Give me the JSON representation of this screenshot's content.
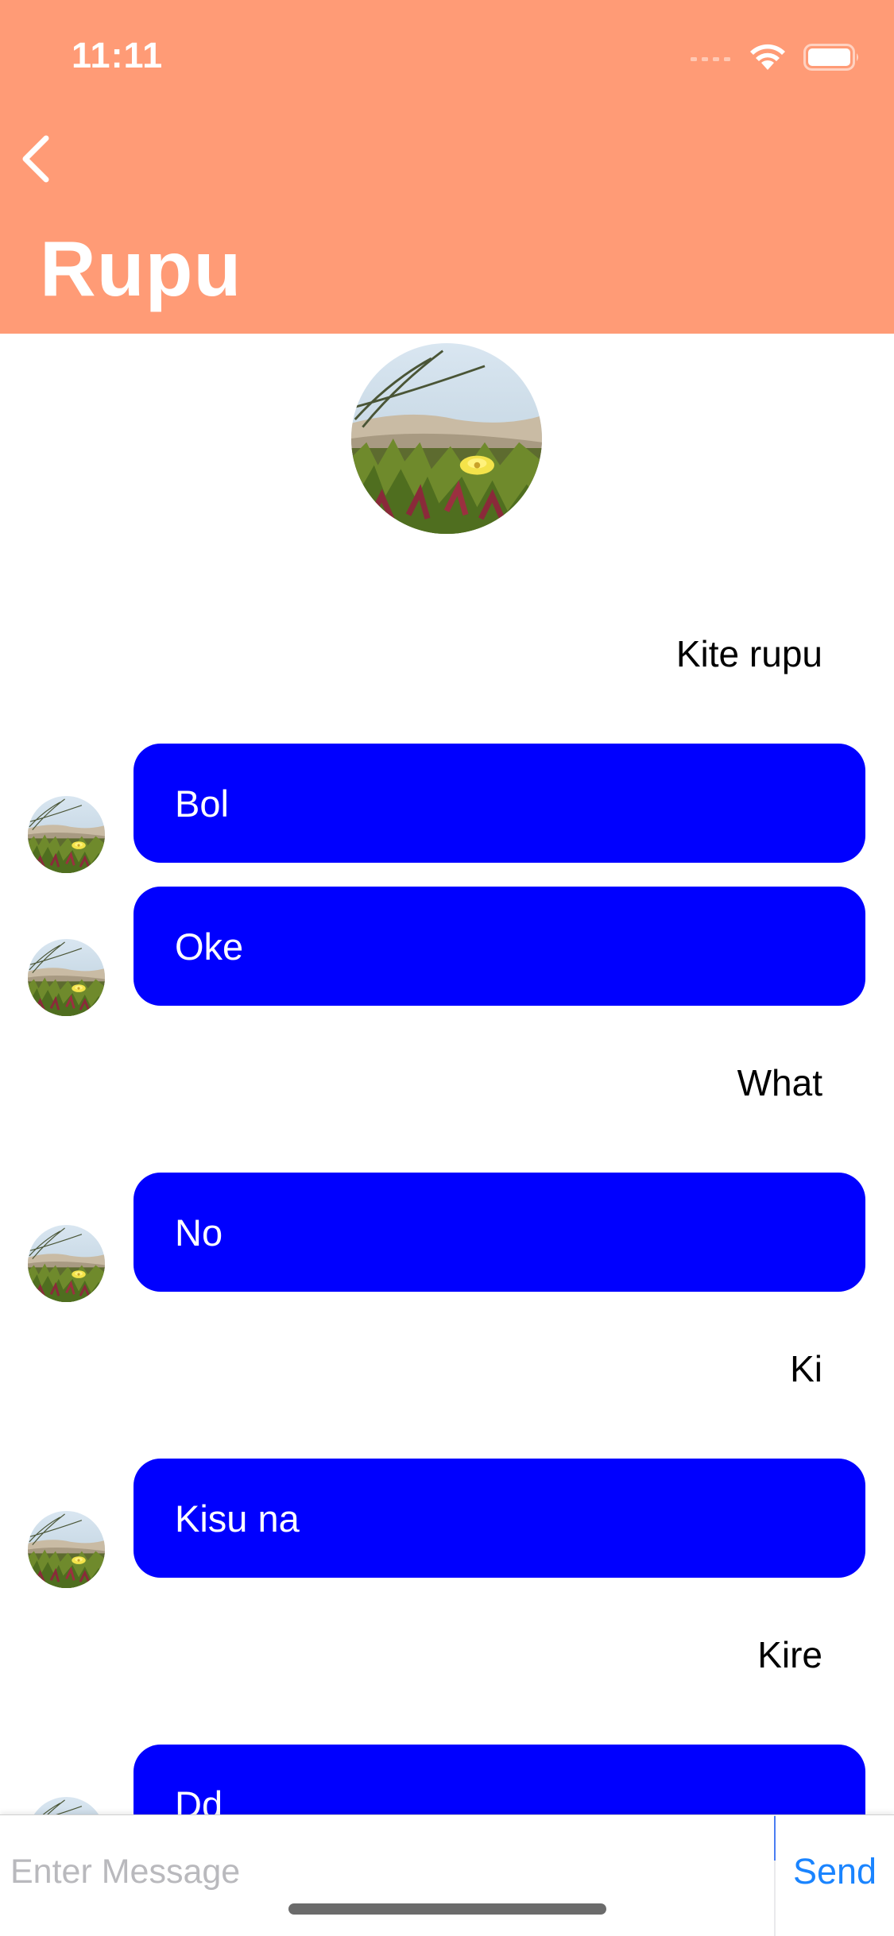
{
  "status_bar": {
    "time": "11:11"
  },
  "header": {
    "title": "Rupu",
    "bg_color": "#ff9b76"
  },
  "messages": [
    {
      "type": "outgoing",
      "text": "Kite rupu"
    },
    {
      "type": "incoming",
      "text": "Bol"
    },
    {
      "type": "incoming",
      "text": "Oke"
    },
    {
      "type": "outgoing",
      "text": "What"
    },
    {
      "type": "incoming",
      "text": "No"
    },
    {
      "type": "outgoing",
      "text": "Ki"
    },
    {
      "type": "incoming",
      "text": "Kisu na"
    },
    {
      "type": "outgoing",
      "text": "Kire"
    },
    {
      "type": "incoming",
      "text": "Dd"
    }
  ],
  "bubble_color": "#0000ff",
  "composer": {
    "placeholder": "Enter Message",
    "send_label": "Send"
  },
  "icons": {
    "back": "chevron-left-icon",
    "signal": "cellular-signal-icon",
    "wifi": "wifi-icon",
    "battery": "battery-icon"
  }
}
